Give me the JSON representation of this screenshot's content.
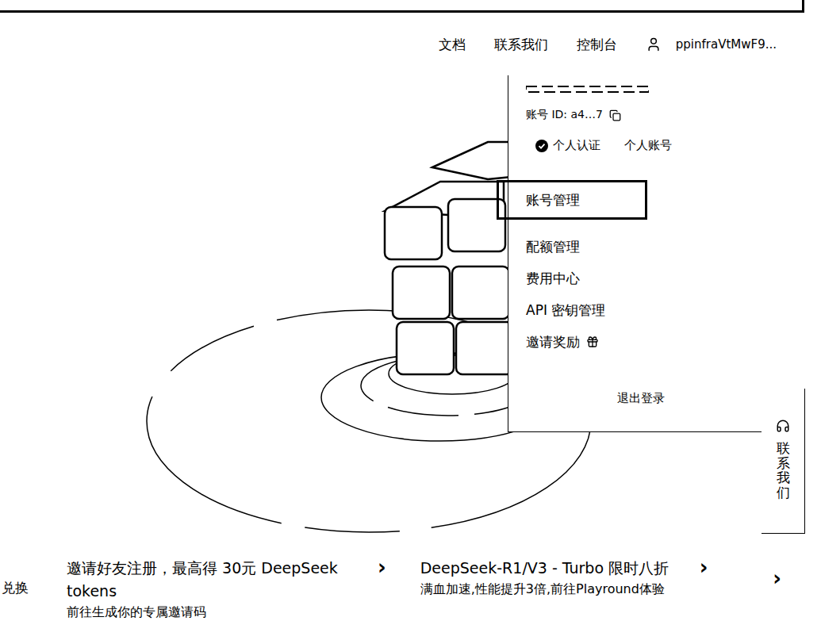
{
  "nav": {
    "links": [
      {
        "label": "文档"
      },
      {
        "label": "联系我们"
      },
      {
        "label": "控制台"
      }
    ],
    "user": "ppinfraVtMwF9..."
  },
  "menu": {
    "account_id": "账号 ID: a4…7",
    "badges": [
      {
        "label": "个人认证",
        "verified": true
      },
      {
        "label": "个人账号",
        "verified": false
      }
    ],
    "items": [
      {
        "label": "账号管理",
        "selected": true,
        "kind": "plain"
      },
      {
        "label": "配额管理",
        "selected": false,
        "kind": "plain"
      },
      {
        "label": "费用中心",
        "selected": false,
        "kind": "plain"
      },
      {
        "label": "API 密钥管理",
        "selected": false,
        "kind": "plain"
      },
      {
        "label": "邀请奖励",
        "selected": false,
        "kind": "gift"
      }
    ],
    "logout": "退出登录"
  },
  "contact_tab": {
    "label": "联系我们"
  },
  "banners": {
    "cut_label": "兑换",
    "items": [
      {
        "title": "邀请好友注册，最高得 30元 DeepSeek tokens",
        "subtitle": "前往生成你的专属邀请码",
        "chevron": "›"
      },
      {
        "title": "DeepSeek-R1/V3 - Turbo 限时八折",
        "subtitle": "满血加速,性能提升3倍,前往Playround体验",
        "chevron": "›"
      }
    ],
    "next": "›"
  }
}
